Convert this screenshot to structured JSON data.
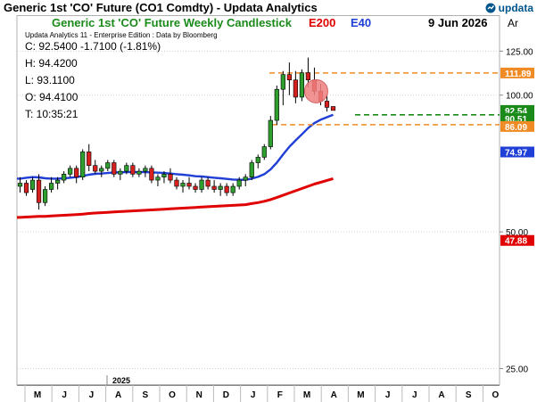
{
  "window": {
    "title": "Generic 1st 'CO' Future (CO1 Comdty) - Updata Analytics",
    "logo_text": "updata"
  },
  "header": {
    "title": "Generic 1st 'CO' Future Weekly Candlestick",
    "e200": "E200",
    "e40": "E40",
    "date": "9 Jun 2026",
    "scale_mode": "Ar"
  },
  "info": {
    "edition": "Updata Analytics 11 - Enterprise Edition : Data by Bloomberg",
    "close": "C: 92.5400  -1.7100 (-1.81%)",
    "high": "H: 94.4200",
    "low": "L: 93.1100",
    "open": "O: 94.4100",
    "time": "T: 10:35:21"
  },
  "colors": {
    "title_green": "#1a8a1a",
    "e200_red": "#e00000",
    "e40_blue": "#1f3fd6",
    "up_candle": "#2e9e2e",
    "down_candle": "#d62020",
    "level_orange": "#f08a24",
    "dashed_green": "#1a8a1a"
  },
  "chart_data": {
    "type": "candlestick",
    "title": "Generic 1st 'CO' Future Weekly Candlestick",
    "y_scale": "log",
    "ylim": [
      23,
      150
    ],
    "y_ticks": [
      25.0,
      50.0,
      100.0,
      125.0
    ],
    "x_month_labels": [
      "M",
      "J",
      "J",
      "A",
      "S",
      "O",
      "N",
      "D",
      "J",
      "F",
      "M",
      "A",
      "M",
      "J",
      "J",
      "A",
      "S",
      "O"
    ],
    "x_year_label": "2025",
    "candles": [
      [
        63,
        66,
        61,
        64
      ],
      [
        64,
        65,
        60,
        61
      ],
      [
        62,
        66,
        61,
        65
      ],
      [
        65,
        67,
        56,
        58
      ],
      [
        58,
        63,
        57,
        62
      ],
      [
        62,
        66,
        61,
        64
      ],
      [
        64,
        66,
        62,
        65
      ],
      [
        65,
        68,
        64,
        67
      ],
      [
        67,
        70,
        66,
        69
      ],
      [
        69,
        70,
        64,
        66
      ],
      [
        66,
        76,
        65,
        75
      ],
      [
        75,
        78,
        68,
        70
      ],
      [
        70,
        72,
        67,
        68
      ],
      [
        68,
        70,
        66,
        69
      ],
      [
        69,
        72,
        68,
        71
      ],
      [
        71,
        72,
        66,
        67
      ],
      [
        67,
        69,
        65,
        68
      ],
      [
        68,
        71,
        67,
        70
      ],
      [
        70,
        71,
        66,
        67
      ],
      [
        67,
        69,
        66,
        68
      ],
      [
        68,
        70,
        66,
        69
      ],
      [
        69,
        70,
        64,
        65
      ],
      [
        65,
        67,
        63,
        66
      ],
      [
        66,
        68,
        64,
        67
      ],
      [
        67,
        69,
        64,
        65
      ],
      [
        65,
        66,
        62,
        63
      ],
      [
        63,
        65,
        61,
        64
      ],
      [
        64,
        66,
        62,
        63
      ],
      [
        63,
        64,
        61,
        62
      ],
      [
        62,
        66,
        61,
        65
      ],
      [
        65,
        66,
        62,
        63
      ],
      [
        63,
        65,
        61,
        62
      ],
      [
        62,
        64,
        60,
        63
      ],
      [
        63,
        64,
        60,
        61
      ],
      [
        61,
        64,
        60,
        63
      ],
      [
        63,
        66,
        62,
        65
      ],
      [
        65,
        67,
        63,
        66
      ],
      [
        66,
        72,
        65,
        71
      ],
      [
        71,
        74,
        69,
        73
      ],
      [
        73,
        78,
        72,
        77
      ],
      [
        77,
        90,
        76,
        88
      ],
      [
        88,
        105,
        86,
        103
      ],
      [
        103,
        113,
        95,
        111
      ],
      [
        111,
        118,
        100,
        108
      ],
      [
        108,
        113,
        96,
        99
      ],
      [
        99,
        114,
        97,
        112
      ],
      [
        112,
        121,
        104,
        108
      ],
      [
        108,
        115,
        100,
        102
      ],
      [
        102,
        106,
        95,
        97
      ],
      [
        97,
        100,
        92,
        94
      ],
      [
        94.41,
        94.42,
        93.11,
        92.54
      ]
    ],
    "series": [
      {
        "name": "E40",
        "color": "#1f3fd6",
        "values": [
          65.5,
          65.8,
          66.0,
          65.9,
          65.6,
          65.5,
          65.5,
          65.6,
          65.8,
          66.0,
          66.4,
          66.8,
          67.1,
          67.2,
          67.4,
          67.6,
          67.6,
          67.7,
          67.7,
          67.7,
          67.7,
          67.6,
          67.5,
          67.4,
          67.2,
          67.0,
          66.8,
          66.6,
          66.3,
          66.2,
          66.0,
          65.8,
          65.6,
          65.4,
          65.2,
          65.1,
          65.1,
          65.5,
          66.1,
          67.0,
          68.6,
          71.0,
          74.0,
          77.0,
          79.5,
          82.0,
          84.6,
          86.8,
          88.3,
          89.4,
          90.5
        ]
      },
      {
        "name": "E200",
        "color": "#e00000",
        "values": [
          53.8,
          53.9,
          54.0,
          54.1,
          54.1,
          54.2,
          54.3,
          54.4,
          54.5,
          54.6,
          54.7,
          54.9,
          55.0,
          55.1,
          55.2,
          55.3,
          55.4,
          55.5,
          55.6,
          55.7,
          55.8,
          55.9,
          56.0,
          56.1,
          56.2,
          56.3,
          56.4,
          56.5,
          56.6,
          56.7,
          56.8,
          56.9,
          57.0,
          57.1,
          57.2,
          57.3,
          57.4,
          57.7,
          58.0,
          58.4,
          58.9,
          59.5,
          60.2,
          60.9,
          61.6,
          62.3,
          63.0,
          63.7,
          64.3,
          64.9,
          65.5
        ]
      }
    ],
    "levels": [
      {
        "value": 111.89,
        "label": "111.89",
        "color": "#f08a24",
        "style": "dashed"
      },
      {
        "value": 86.09,
        "label": "86.09",
        "color": "#f08a24",
        "style": "dashed"
      },
      {
        "value": 90.51,
        "label": "90.51",
        "color": "#1a8a1a",
        "style": "dashed"
      }
    ],
    "axis_labels": [
      {
        "value": 92.54,
        "label": "92.54",
        "bg": "#1a8a1a"
      },
      {
        "value": 90.51,
        "label": "90.51",
        "bg": "#1a8a1a"
      },
      {
        "value": 111.89,
        "label": "111.89",
        "bg": "#f08a24"
      },
      {
        "value": 86.09,
        "label": "86.09",
        "bg": "#f08a24"
      },
      {
        "value": 74.97,
        "label": "74.97",
        "bg": "#1f3fd6"
      },
      {
        "value": 47.88,
        "label": "47.88",
        "bg": "#e00000"
      }
    ],
    "highlight": {
      "candle_index": 47,
      "value": 102,
      "color": "#f08080"
    }
  }
}
